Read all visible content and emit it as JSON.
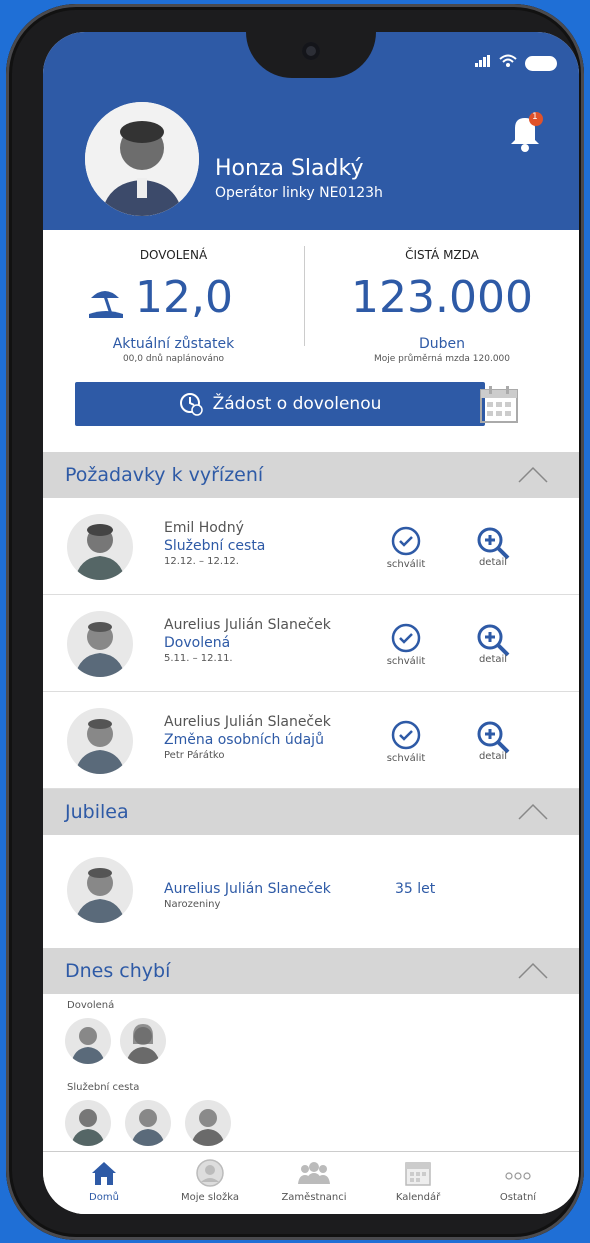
{
  "profile": {
    "name": "Honza Sladký",
    "role": "Operátor linky NE0123h",
    "notification_count": "1"
  },
  "stats": {
    "vacation_title": "DOVOLENÁ",
    "vacation_value": "12,0",
    "vacation_sub": "Aktuální zůstatek",
    "vacation_tiny": "00,0 dnů naplánováno",
    "salary_title": "ČISTÁ MZDA",
    "salary_value": "123.000",
    "salary_sub": "Duben",
    "salary_tiny": "Moje průměrná mzda 120.000"
  },
  "request_button": "Žádost o dovolenou",
  "sections": {
    "pending": "Požadavky k vyřízení",
    "jubilee": "Jubilea",
    "absent": "Dnes chybí"
  },
  "pending": [
    {
      "name": "Emil Hodný",
      "type": "Služební cesta",
      "date": "12.12. – 12.12.",
      "approve": "schválit",
      "detail": "detail"
    },
    {
      "name": "Aurelius Julián Slaneček",
      "type": "Dovolená",
      "date": "5.11. – 12.11.",
      "approve": "schválit",
      "detail": "detail"
    },
    {
      "name": "Aurelius Julián Slaneček",
      "type": "Změna osobních údajů",
      "date": "Petr Párátko",
      "approve": "schválit",
      "detail": "detail"
    }
  ],
  "jubilee": {
    "name": "Aurelius Julián Slaneček",
    "event": "Narozeniny",
    "years": "35 let"
  },
  "absent": {
    "vacation_label": "Dovolená",
    "trip_label": "Služební cesta"
  },
  "nav": {
    "home": "Domů",
    "folder": "Moje složka",
    "employees": "Zaměstnanci",
    "calendar": "Kalendář",
    "other": "Ostatní"
  },
  "colors": {
    "brand": "#2e5aa6",
    "section_bg": "#d6d6d6",
    "notification": "#e0522a"
  }
}
